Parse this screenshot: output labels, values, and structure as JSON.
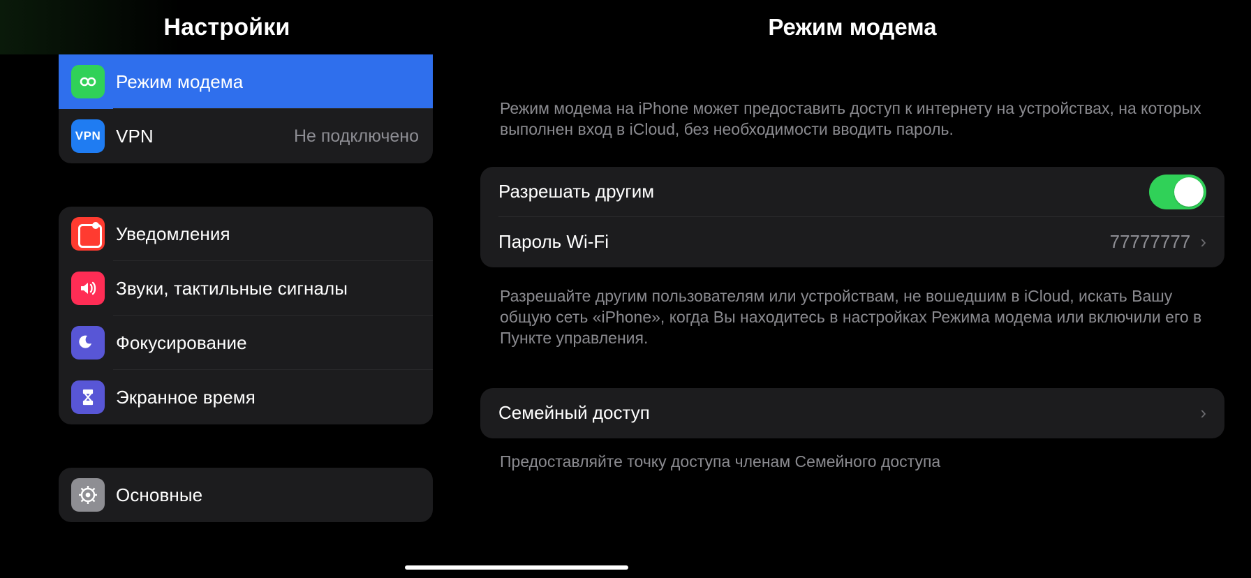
{
  "sidebar": {
    "title": "Настройки",
    "groups": [
      {
        "items": [
          {
            "key": "hotspot",
            "label": "Режим модема",
            "status": "",
            "selected": true,
            "icon": "hotspot"
          },
          {
            "key": "vpn",
            "label": "VPN",
            "status": "Не подключено",
            "selected": false,
            "icon": "vpn"
          }
        ]
      },
      {
        "items": [
          {
            "key": "notifications",
            "label": "Уведомления",
            "icon": "notifications"
          },
          {
            "key": "sounds",
            "label": "Звуки, тактильные сигналы",
            "icon": "sounds"
          },
          {
            "key": "focus",
            "label": "Фокусирование",
            "icon": "focus"
          },
          {
            "key": "screentime",
            "label": "Экранное время",
            "icon": "screentime"
          }
        ]
      },
      {
        "items": [
          {
            "key": "general",
            "label": "Основные",
            "icon": "general"
          }
        ]
      }
    ]
  },
  "detail": {
    "title": "Режим модема",
    "intro": "Режим модема на iPhone может предоставить доступ к интернету на устройствах, на которых выполнен вход в iCloud, без необходимости вводить пароль.",
    "rows": {
      "allow_others_label": "Разрешать другим",
      "allow_others_on": true,
      "wifi_password_label": "Пароль Wi-Fi",
      "wifi_password_value": "77777777"
    },
    "note": "Разрешайте другим пользователям или устройствам, не вошедшим в iCloud, искать Вашу общую сеть «iPhone», когда Вы находитесь в настройках Режима модема или включили его в Пункте управления.",
    "family_label": "Семейный доступ",
    "family_note": "Предоставляйте точку доступа членам Семейного доступа"
  }
}
